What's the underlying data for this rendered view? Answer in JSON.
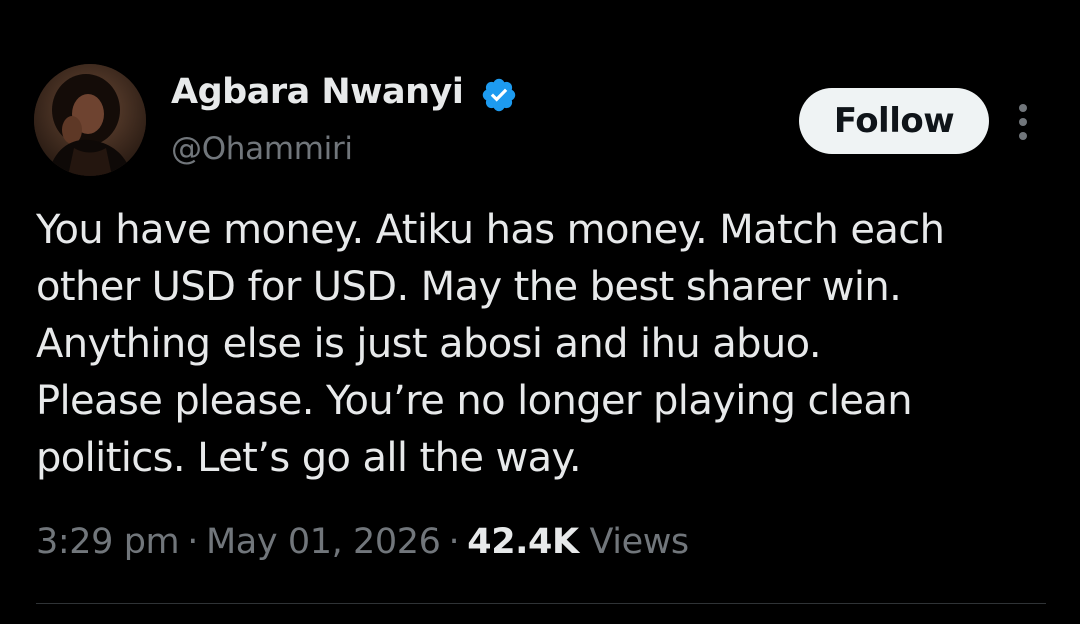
{
  "author": {
    "name": "Agbara Nwanyi",
    "handle": "@Ohammiri",
    "verified": true,
    "avatar_icon": "profile-photo-avatar"
  },
  "actions": {
    "follow_label": "Follow",
    "more_icon": "vertical-ellipsis-icon"
  },
  "tweet": {
    "lines": [
      "You have money. Atiku has money. Match each",
      "other USD for USD. May the best sharer win.",
      "Anything else is just abosi and ihu abuo.",
      "Please please. You’re no longer playing clean",
      "politics. Let’s go all the way."
    ]
  },
  "meta": {
    "time": "3:29 pm",
    "separator": "·",
    "date": "May 01, 2026",
    "views_count": "42.4K",
    "views_label": "Views"
  },
  "colors": {
    "background": "#000000",
    "text_primary": "#e7e9ea",
    "text_secondary": "#71767b",
    "verified_blue": "#1d9bf0",
    "follow_bg": "#eff3f4"
  }
}
